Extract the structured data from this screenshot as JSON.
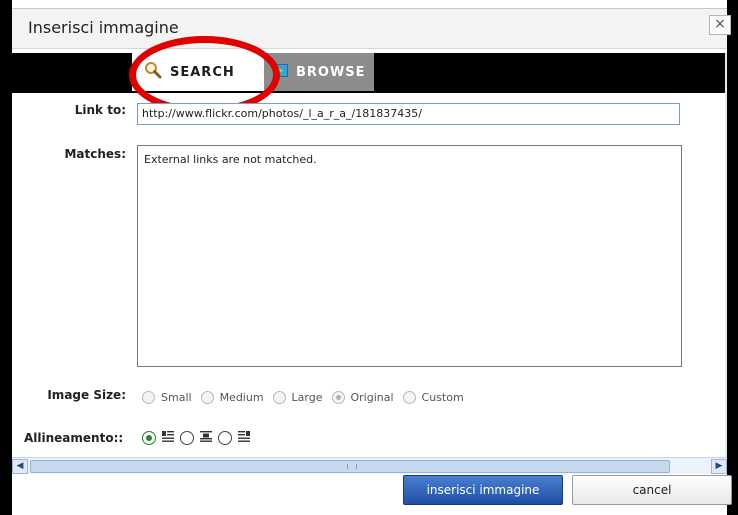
{
  "dialog": {
    "title": "Inserisci immagine",
    "close_glyph": "×"
  },
  "tabs": [
    {
      "label": "SEARCH",
      "icon": "search-icon",
      "active": true
    },
    {
      "label": "BROWSE",
      "icon": "browse-icon",
      "active": false
    }
  ],
  "form": {
    "link_label": "Link to:",
    "link_value": "http://www.flickr.com/photos/_l_a_r_a_/181837435/",
    "matches_label": "Matches:",
    "matches_text": "External links are not matched.",
    "size_label": "Image Size:",
    "size_options": [
      "Small",
      "Medium",
      "Large",
      "Original",
      "Custom"
    ],
    "size_selected": "Original",
    "align_label": "Allineamento::",
    "align_options": [
      "align-left-icon",
      "align-center-icon",
      "align-right-icon"
    ],
    "align_selected": "align-left-icon"
  },
  "buttons": {
    "submit_label": "inserisci immagine",
    "cancel_label": "cancel"
  },
  "colors": {
    "highlight_circle": "#e10000",
    "tab_inactive": "#8c8c8c",
    "primary_button": "#2a5db0"
  }
}
